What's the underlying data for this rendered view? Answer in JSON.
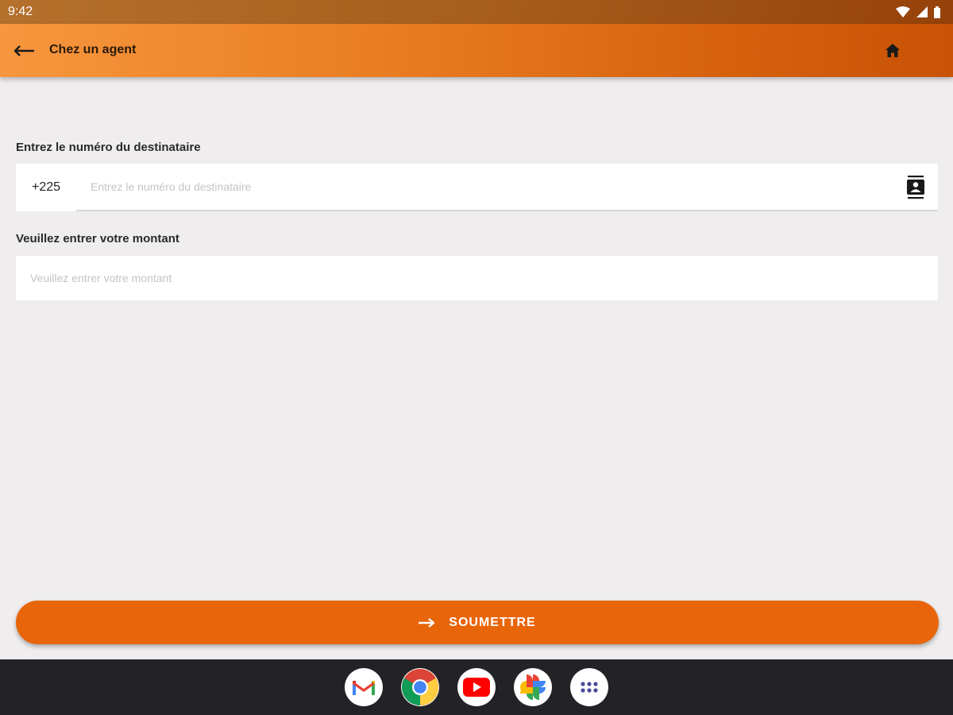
{
  "status_bar": {
    "time": "9:42",
    "icons": [
      "wifi-icon",
      "signal-icon",
      "battery-icon"
    ]
  },
  "app_bar": {
    "title": "Chez un agent",
    "back_icon": "arrow-left-icon",
    "home_icon": "home-icon"
  },
  "form": {
    "recipient": {
      "label": "Entrez le numéro du destinataire",
      "prefix": "+225",
      "placeholder": "Entrez le numéro du destinataire",
      "value": "",
      "contact_icon": "contacts-icon"
    },
    "amount": {
      "label": "Veuillez entrer votre montant",
      "placeholder": "Veuillez entrer votre montant",
      "value": ""
    },
    "submit": {
      "label": "SOUMETTRE",
      "icon": "arrow-right-icon"
    }
  },
  "dock": {
    "apps": [
      {
        "name": "gmail-icon"
      },
      {
        "name": "chrome-icon"
      },
      {
        "name": "youtube-icon"
      },
      {
        "name": "photos-icon"
      },
      {
        "name": "app-drawer-icon"
      }
    ]
  },
  "colors": {
    "accent": "#e8650a",
    "app_bar_start": "#f7963e",
    "app_bar_end": "#c85205",
    "background": "#efedee",
    "nav_bar": "#232226"
  }
}
